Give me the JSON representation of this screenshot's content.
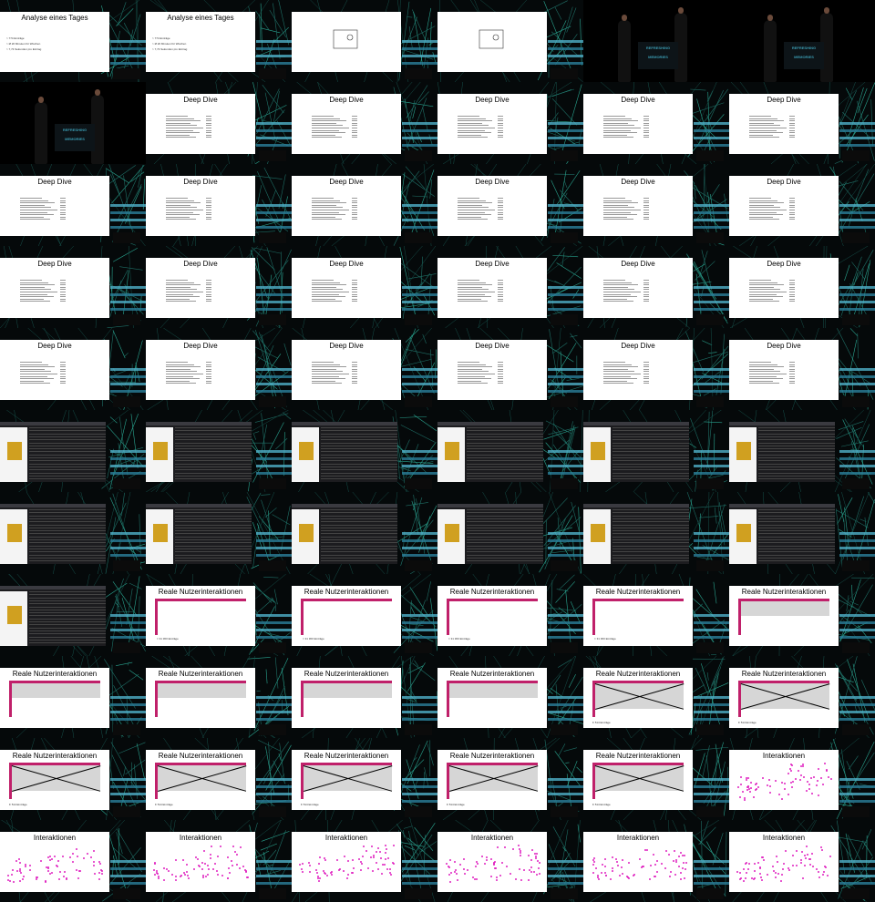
{
  "grid": {
    "cols": 6,
    "rows": 11
  },
  "colors": {
    "background": "#000000",
    "accent_pink": "#c0206a",
    "dots": "#e020c0",
    "logo_teal": "#3a9ab0"
  },
  "texts": {
    "analyse": "Analyse eines Tages",
    "deep": "Deep Dive",
    "reale": "Reale Nutzerinteraktionen",
    "inter": "Interaktionen",
    "cap1": "= 31 360 Einträge",
    "cap2": "Σ 514 Einträge",
    "b1": "> 774 Einträge",
    "b2": "> Ø 20 Minuten für Wischen",
    "b3": "> 7,74 Sekunden pro Eintrag"
  },
  "podium_text": [
    "REFRESHING",
    "MEMORIES"
  ],
  "cells": [
    "analyse",
    "analyse",
    "comic",
    "comic",
    "stage",
    "stage",
    "stage",
    "deep",
    "deep",
    "deep",
    "deep",
    "deep",
    "deep",
    "deep",
    "deep",
    "deep",
    "deep",
    "deep",
    "deep",
    "deep",
    "deep",
    "deep",
    "deep",
    "deep",
    "deep",
    "deep",
    "deep",
    "deep",
    "deep",
    "deep",
    "app",
    "app",
    "app",
    "app",
    "app",
    "app",
    "app",
    "app",
    "app",
    "app",
    "app",
    "app",
    "app",
    "reale_cap1",
    "reale_cap1",
    "reale_cap1",
    "reale_cap1",
    "reale_gray",
    "reale_gray",
    "reale_gray",
    "reale_gray",
    "reale_gray",
    "reale_x",
    "reale_x",
    "reale_x",
    "reale_x",
    "reale_x",
    "reale_x",
    "reale_x",
    "inter",
    "inter",
    "inter",
    "inter",
    "inter",
    "inter",
    "inter"
  ]
}
